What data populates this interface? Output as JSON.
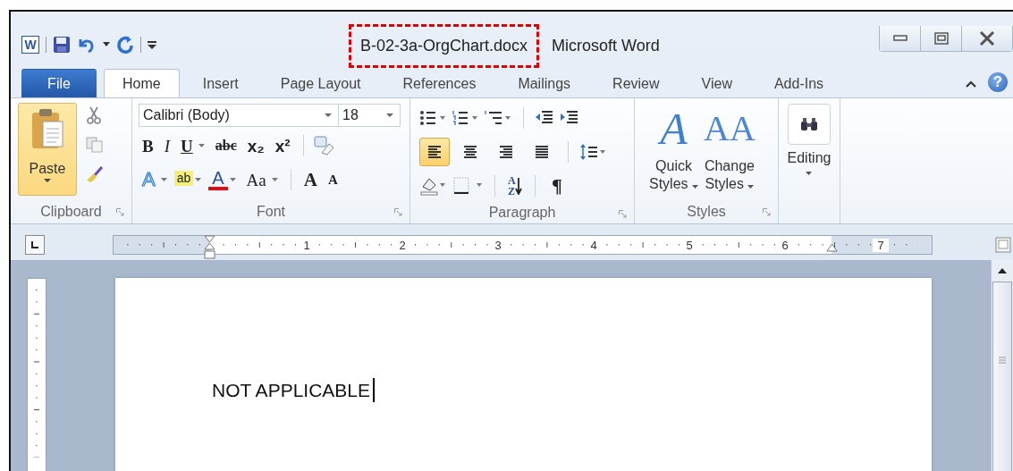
{
  "title_bar": {
    "app_glyph": "W",
    "document": "B-02-3a-OrgChart.docx",
    "document_highlighted": true,
    "app": "Microsoft Word"
  },
  "tabs": [
    {
      "label": "File",
      "kind": "file",
      "selected": false
    },
    {
      "label": "Home",
      "kind": "tab",
      "selected": true
    },
    {
      "label": "Insert",
      "kind": "tab",
      "selected": false
    },
    {
      "label": "Page Layout",
      "kind": "tab",
      "selected": false
    },
    {
      "label": "References",
      "kind": "tab",
      "selected": false
    },
    {
      "label": "Mailings",
      "kind": "tab",
      "selected": false
    },
    {
      "label": "Review",
      "kind": "tab",
      "selected": false
    },
    {
      "label": "View",
      "kind": "tab",
      "selected": false
    },
    {
      "label": "Add-Ins",
      "kind": "tab",
      "selected": false
    }
  ],
  "help_glyph": "?",
  "ribbon": {
    "clipboard": {
      "label": "Clipboard",
      "paste": {
        "label": "Paste",
        "hovered": true
      }
    },
    "font": {
      "label": "Font",
      "font_name": "Calibri (Body)",
      "font_size": "18",
      "row1": [
        {
          "glyph": "B",
          "kind": "bold",
          "dropdown": false
        },
        {
          "glyph": "I",
          "kind": "italic",
          "dropdown": false
        },
        {
          "glyph": "U",
          "kind": "underline",
          "dropdown": true
        },
        {
          "glyph": "abc",
          "kind": "strike",
          "dropdown": false
        },
        {
          "glyph": "x₂",
          "kind": "plain",
          "dropdown": false
        },
        {
          "glyph": "x²",
          "kind": "plain",
          "dropdown": false
        }
      ],
      "row2": [
        {
          "glyph": "A",
          "kind": "effects",
          "dropdown": true
        },
        {
          "glyph": "ab",
          "kind": "highlight",
          "dropdown": true
        },
        {
          "glyph": "A",
          "kind": "color",
          "dropdown": true
        },
        {
          "glyph": "Aa",
          "kind": "case",
          "dropdown": true
        },
        {
          "glyph": "A",
          "kind": "grow",
          "dropdown": false
        },
        {
          "glyph": "A",
          "kind": "shrink",
          "dropdown": false
        }
      ]
    },
    "paragraph": {
      "label": "Paragraph",
      "alignments": [
        {
          "kind": "left",
          "selected": true
        },
        {
          "kind": "center",
          "selected": false
        },
        {
          "kind": "right",
          "selected": false
        },
        {
          "kind": "justify",
          "selected": false
        }
      ],
      "sort_glyph": "AZ",
      "pilcrow": "¶"
    },
    "styles": {
      "label": "Styles",
      "buttons": [
        {
          "glyph": "A",
          "kind": "quick",
          "line1": "Quick",
          "line2": "Styles"
        },
        {
          "glyph": "AA",
          "kind": "change",
          "line1": "Change",
          "line2": "Styles"
        }
      ]
    },
    "editing": {
      "label": "Editing"
    }
  },
  "ruler": {
    "labels": [
      "1",
      "2",
      "3",
      "4",
      "5",
      "6",
      "7"
    ]
  },
  "document": {
    "text": "NOT APPLICABLE"
  }
}
